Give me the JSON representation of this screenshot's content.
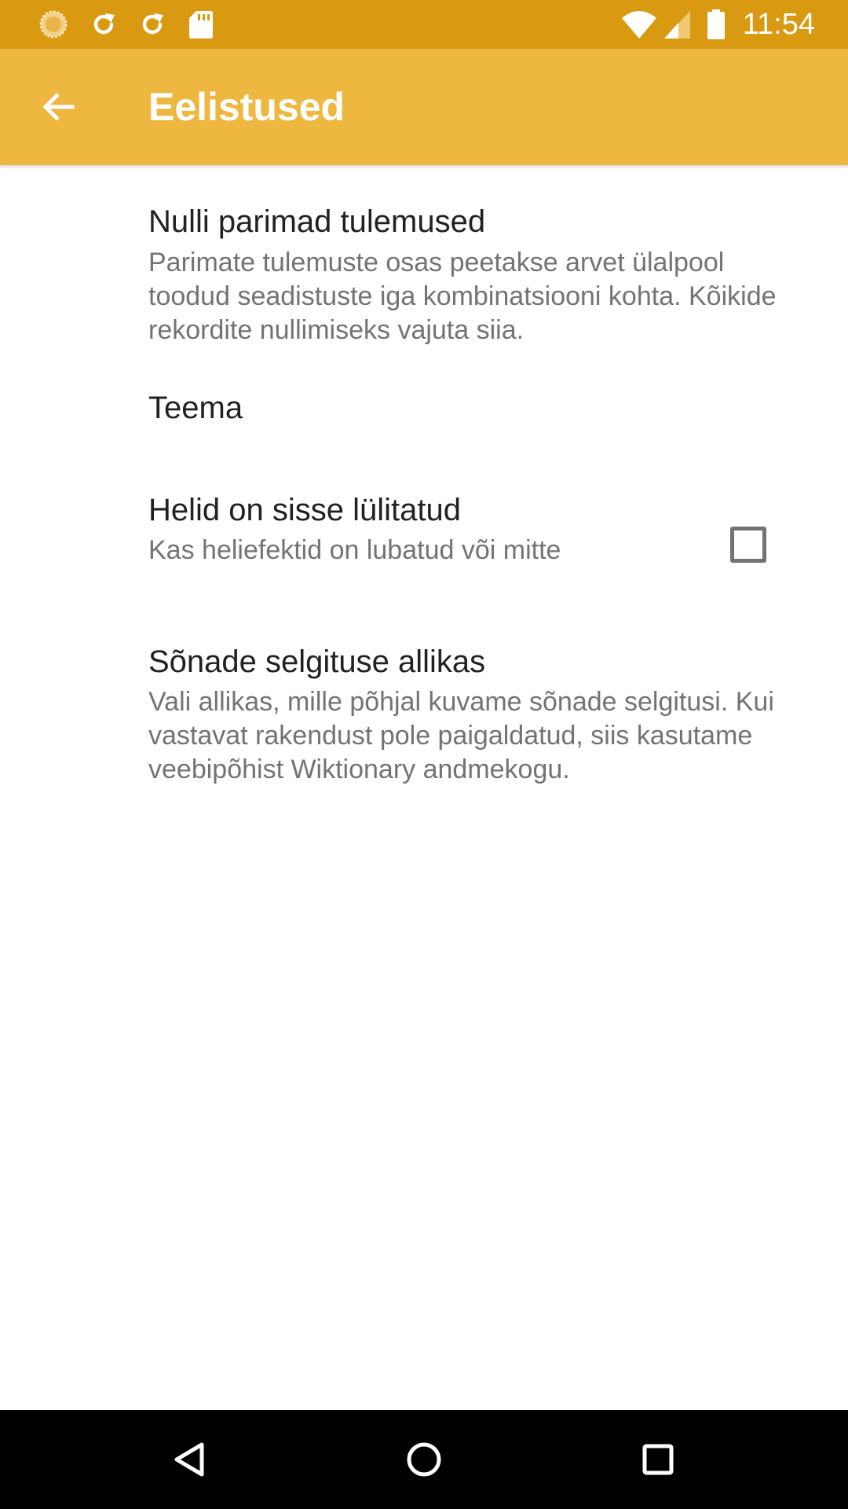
{
  "status_bar": {
    "time": "11:54",
    "left_icons": [
      "sun-notification-icon",
      "sync-icon",
      "sync-icon",
      "sd-card-icon"
    ],
    "right_icons": [
      "wifi-icon",
      "cellular-signal-icon",
      "battery-icon"
    ],
    "color": "#D99A12"
  },
  "app_bar": {
    "title": "Eelistused",
    "back_icon": "arrow-back-icon",
    "color": "#EDB740"
  },
  "preferences": [
    {
      "title": "Nulli parimad tulemused",
      "summary": "Parimate tulemuste osas peetakse arvet ülalpool toodud seadistuste iga kombinatsiooni kohta. Kõikide rekordite nullimiseks vajuta siia."
    },
    {
      "title": "Teema"
    },
    {
      "title": "Helid on sisse lülitatud",
      "summary": "Kas heliefektid on lubatud või mitte",
      "checked": false
    },
    {
      "title": "Sõnade selgituse allikas",
      "summary": "Vali allikas, mille põhjal kuvame sõnade selgitusi. Kui vastavat rakendust pole paigaldatud, siis kasutame veebipõhist Wiktionary andmekogu."
    }
  ],
  "nav_bar": {
    "buttons": [
      "back-triangle-icon",
      "home-circle-icon",
      "recents-square-icon"
    ]
  }
}
